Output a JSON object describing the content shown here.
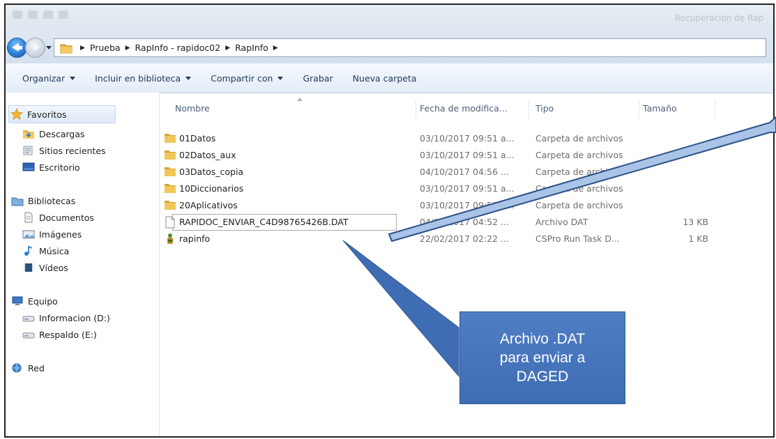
{
  "window": {
    "title": "Recuperacion de Rap"
  },
  "address": {
    "crumbs": [
      "Prueba",
      "RapInfo - rapidoc02",
      "RapInfo"
    ]
  },
  "toolbar": {
    "organize": "Organizar",
    "include_library": "Incluir en biblioteca",
    "share_with": "Compartir con",
    "burn": "Grabar",
    "new_folder": "Nueva carpeta"
  },
  "sidebar": {
    "favorites": "Favoritos",
    "downloads": "Descargas",
    "recent": "Sitios recientes",
    "desktop": "Escritorio",
    "libraries": "Bibliotecas",
    "documents": "Documentos",
    "images": "Imágenes",
    "music": "Música",
    "videos": "Vídeos",
    "computer": "Equipo",
    "drive_d": "Informacion (D:)",
    "drive_e": "Respaldo (E:)",
    "network": "Red"
  },
  "columns": {
    "name": "Nombre",
    "date": "Fecha de modifica...",
    "type": "Tipo",
    "size": "Tamaño"
  },
  "files": [
    {
      "name": "01Datos",
      "date": "03/10/2017 09:51 a...",
      "type": "Carpeta de archivos",
      "size": "",
      "icon": "folder-icon"
    },
    {
      "name": "02Datos_aux",
      "date": "03/10/2017 09:51 a...",
      "type": "Carpeta de archivos",
      "size": "",
      "icon": "folder-icon"
    },
    {
      "name": "03Datos_copia",
      "date": "04/10/2017 04:56 ...",
      "type": "Carpeta de archivos",
      "size": "",
      "icon": "folder-icon"
    },
    {
      "name": "10Diccionarios",
      "date": "03/10/2017 09:51 a...",
      "type": "Carpeta de archivos",
      "size": "",
      "icon": "folder-icon"
    },
    {
      "name": "20Aplicativos",
      "date": "03/10/2017 09:51 a...",
      "type": "Carpeta de archivos",
      "size": "",
      "icon": "folder-icon"
    },
    {
      "name": "RAPIDOC_ENVIAR_C4D98765426B.DAT",
      "date": "04/10/2017 04:52 ...",
      "type": "Archivo DAT",
      "size": "13 KB",
      "icon": "document-icon"
    },
    {
      "name": "rapinfo",
      "date": "22/02/2017 02:22 ...",
      "type": "CSPro Run Task D...",
      "size": "1 KB",
      "icon": "cspro-task-icon"
    }
  ],
  "callout": {
    "lines": [
      "Archivo .DAT",
      "para enviar a",
      "DAGED"
    ]
  },
  "colors": {
    "callout_fill": "#4472c4",
    "folder": "#e8b53a"
  }
}
